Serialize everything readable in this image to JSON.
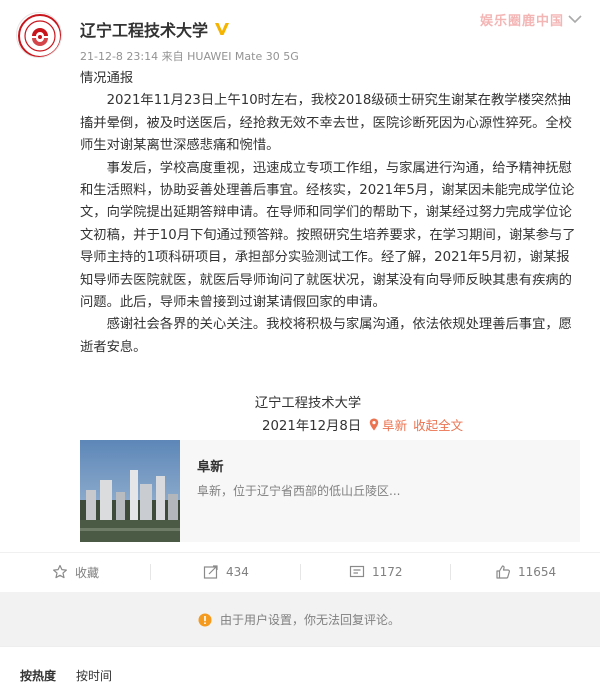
{
  "watermark": "娱乐圈鹿中国",
  "post": {
    "username": "辽宁工程技术大学",
    "verified": true,
    "meta": "21-12-8 23:14 来自 HUAWEI Mate 30 5G",
    "heading": "情况通报",
    "paragraphs": [
      "2021年11月23日上午10时左右，我校2018级硕士研究生谢某在教学楼突然抽搐并晕倒，被及时送医后，经抢救无效不幸去世，医院诊断死因为心源性猝死。全校师生对谢某离世深感悲痛和惋惜。",
      "事发后，学校高度重视，迅速成立专项工作组，与家属进行沟通，给予精神抚慰和生活照料，协助妥善处理善后事宜。经核实，2021年5月，谢某因未能完成学位论文，向学院提出延期答辩申请。在导师和同学们的帮助下，谢某经过努力完成学位论文初稿，并于10月下旬通过预答辩。按照研究生培养要求，在学习期间，谢某参与了导师主持的1项科研项目，承担部分实验测试工作。经了解，2021年5月初，谢某报知导师去医院就医，就医后导师询问了就医状况，谢某没有向导师反映其患有疾病的问题。此后，导师未曾接到过谢某请假回家的申请。",
      "感谢社会各界的关心关注。我校将积极与家属沟通，依法依规处理善后事宜，愿逝者安息。"
    ],
    "signature_name": "辽宁工程技术大学",
    "signature_date": "2021年12月8日",
    "location": "阜新",
    "collapse_label": "收起全文"
  },
  "location_card": {
    "title": "阜新",
    "description": "阜新，位于辽宁省西部的低山丘陵区..."
  },
  "actions": {
    "favorite_label": "收藏",
    "repost_count": "434",
    "comment_count": "1172",
    "like_count": "11654"
  },
  "notice": "由于用户设置，你无法回复评论。",
  "sort_tabs": [
    "按热度",
    "按时间"
  ],
  "colors": {
    "accent_orange": "#eb7350",
    "verified_yellow": "#f5b400",
    "warning_orange": "#f49a1e"
  }
}
